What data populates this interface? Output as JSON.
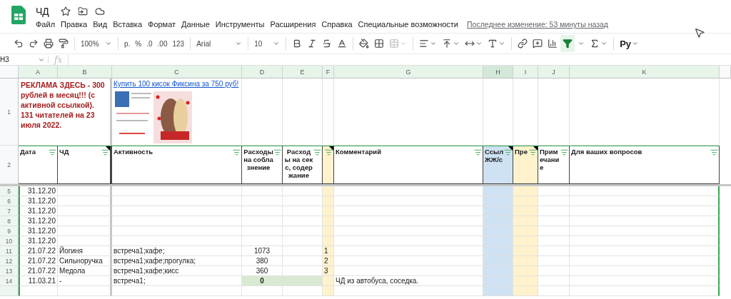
{
  "document": {
    "title": "ЧД",
    "menu": [
      "Файл",
      "Правка",
      "Вид",
      "Вставка",
      "Формат",
      "Данные",
      "Инструменты",
      "Расширения",
      "Справка",
      "Специальные возможности"
    ],
    "last_edit": "Последнее изменение: 53 минуты назад"
  },
  "toolbar": {
    "zoom": "100%",
    "number_formats": [
      "р.",
      "%",
      ".0",
      ".00",
      "123"
    ],
    "font": "Arial",
    "font_size": "10",
    "filter_on": true,
    "input_tools": "Ру"
  },
  "formula_bar": {
    "cell": "H3",
    "fx": "fx"
  },
  "columns": [
    {
      "letter": "A",
      "selected": false
    },
    {
      "letter": "B",
      "selected": false
    },
    {
      "letter": "C",
      "selected": false
    },
    {
      "letter": "D",
      "selected": false
    },
    {
      "letter": "E",
      "selected": false
    },
    {
      "letter": "F",
      "selected": false,
      "color": "#fff2cc"
    },
    {
      "letter": "G",
      "selected": false
    },
    {
      "letter": "H",
      "selected": true,
      "color": "#cfe2f3"
    },
    {
      "letter": "I",
      "selected": false,
      "color": "#fff2cc"
    },
    {
      "letter": "J",
      "selected": false
    },
    {
      "letter": "K",
      "selected": false
    }
  ],
  "ad_row": {
    "number": "1",
    "ad_text": "РЕКЛАМА ЗДЕСЬ - 300 рублей в месяц!!! (с активной ссылкой). 131 читателей на 23 июля 2022.",
    "link": "Купить 100 кисок Фиксина за 750 руб!"
  },
  "header_row": {
    "number": "2",
    "cells": [
      {
        "label": "Дата",
        "note": false
      },
      {
        "label": "ЧД",
        "note": true
      },
      {
        "label": "Активность",
        "note": false
      },
      {
        "label": "Расходы на соблазнение",
        "note": false
      },
      {
        "label": "Расходы на секс, содержание",
        "note": false
      },
      {
        "note": true
      },
      {
        "label": "Комментарий",
        "note": false
      },
      {
        "label": "Ссыл ЖЖ/с",
        "note": true
      },
      {
        "label": "Пре",
        "note": true
      },
      {
        "label": "Примечание",
        "note": false
      },
      {
        "label": "Для ваших вопросов",
        "note": false
      }
    ]
  },
  "rows": [
    {
      "number": "5",
      "date": "31.12.20",
      "costs_highlighted": false
    },
    {
      "number": "6",
      "date": "31.12.20",
      "costs_highlighted": false
    },
    {
      "number": "7",
      "date": "31.12.20",
      "costs_highlighted": false
    },
    {
      "number": "8",
      "date": "31.12.20",
      "costs_highlighted": false
    },
    {
      "number": "9",
      "date": "31.12.20",
      "costs_highlighted": false
    },
    {
      "number": "10",
      "date": "31.12.20",
      "costs_highlighted": false
    },
    {
      "number": "11",
      "date": "21.07.22",
      "name": "Йогиня",
      "activity": "встреча1;кафе;",
      "cost_seduction": "1073",
      "index": "1",
      "costs_highlighted": false
    },
    {
      "number": "12",
      "date": "21.07.22",
      "name": "Сильноручка",
      "activity": "встреча1;кафе;прогулка;",
      "cost_seduction": "380",
      "index": "2",
      "costs_highlighted": false
    },
    {
      "number": "13",
      "date": "21.07.22",
      "name": "Медола",
      "activity": "встреча1;кафе;кисс",
      "cost_seduction": "360",
      "index": "3",
      "costs_highlighted": false
    },
    {
      "number": "14",
      "date": "11.03.21",
      "name": "-",
      "activity": "встреча1;",
      "cost_seduction": "0",
      "comment": "ЧД из автобуса, соседка.",
      "costs_highlighted": true
    }
  ]
}
